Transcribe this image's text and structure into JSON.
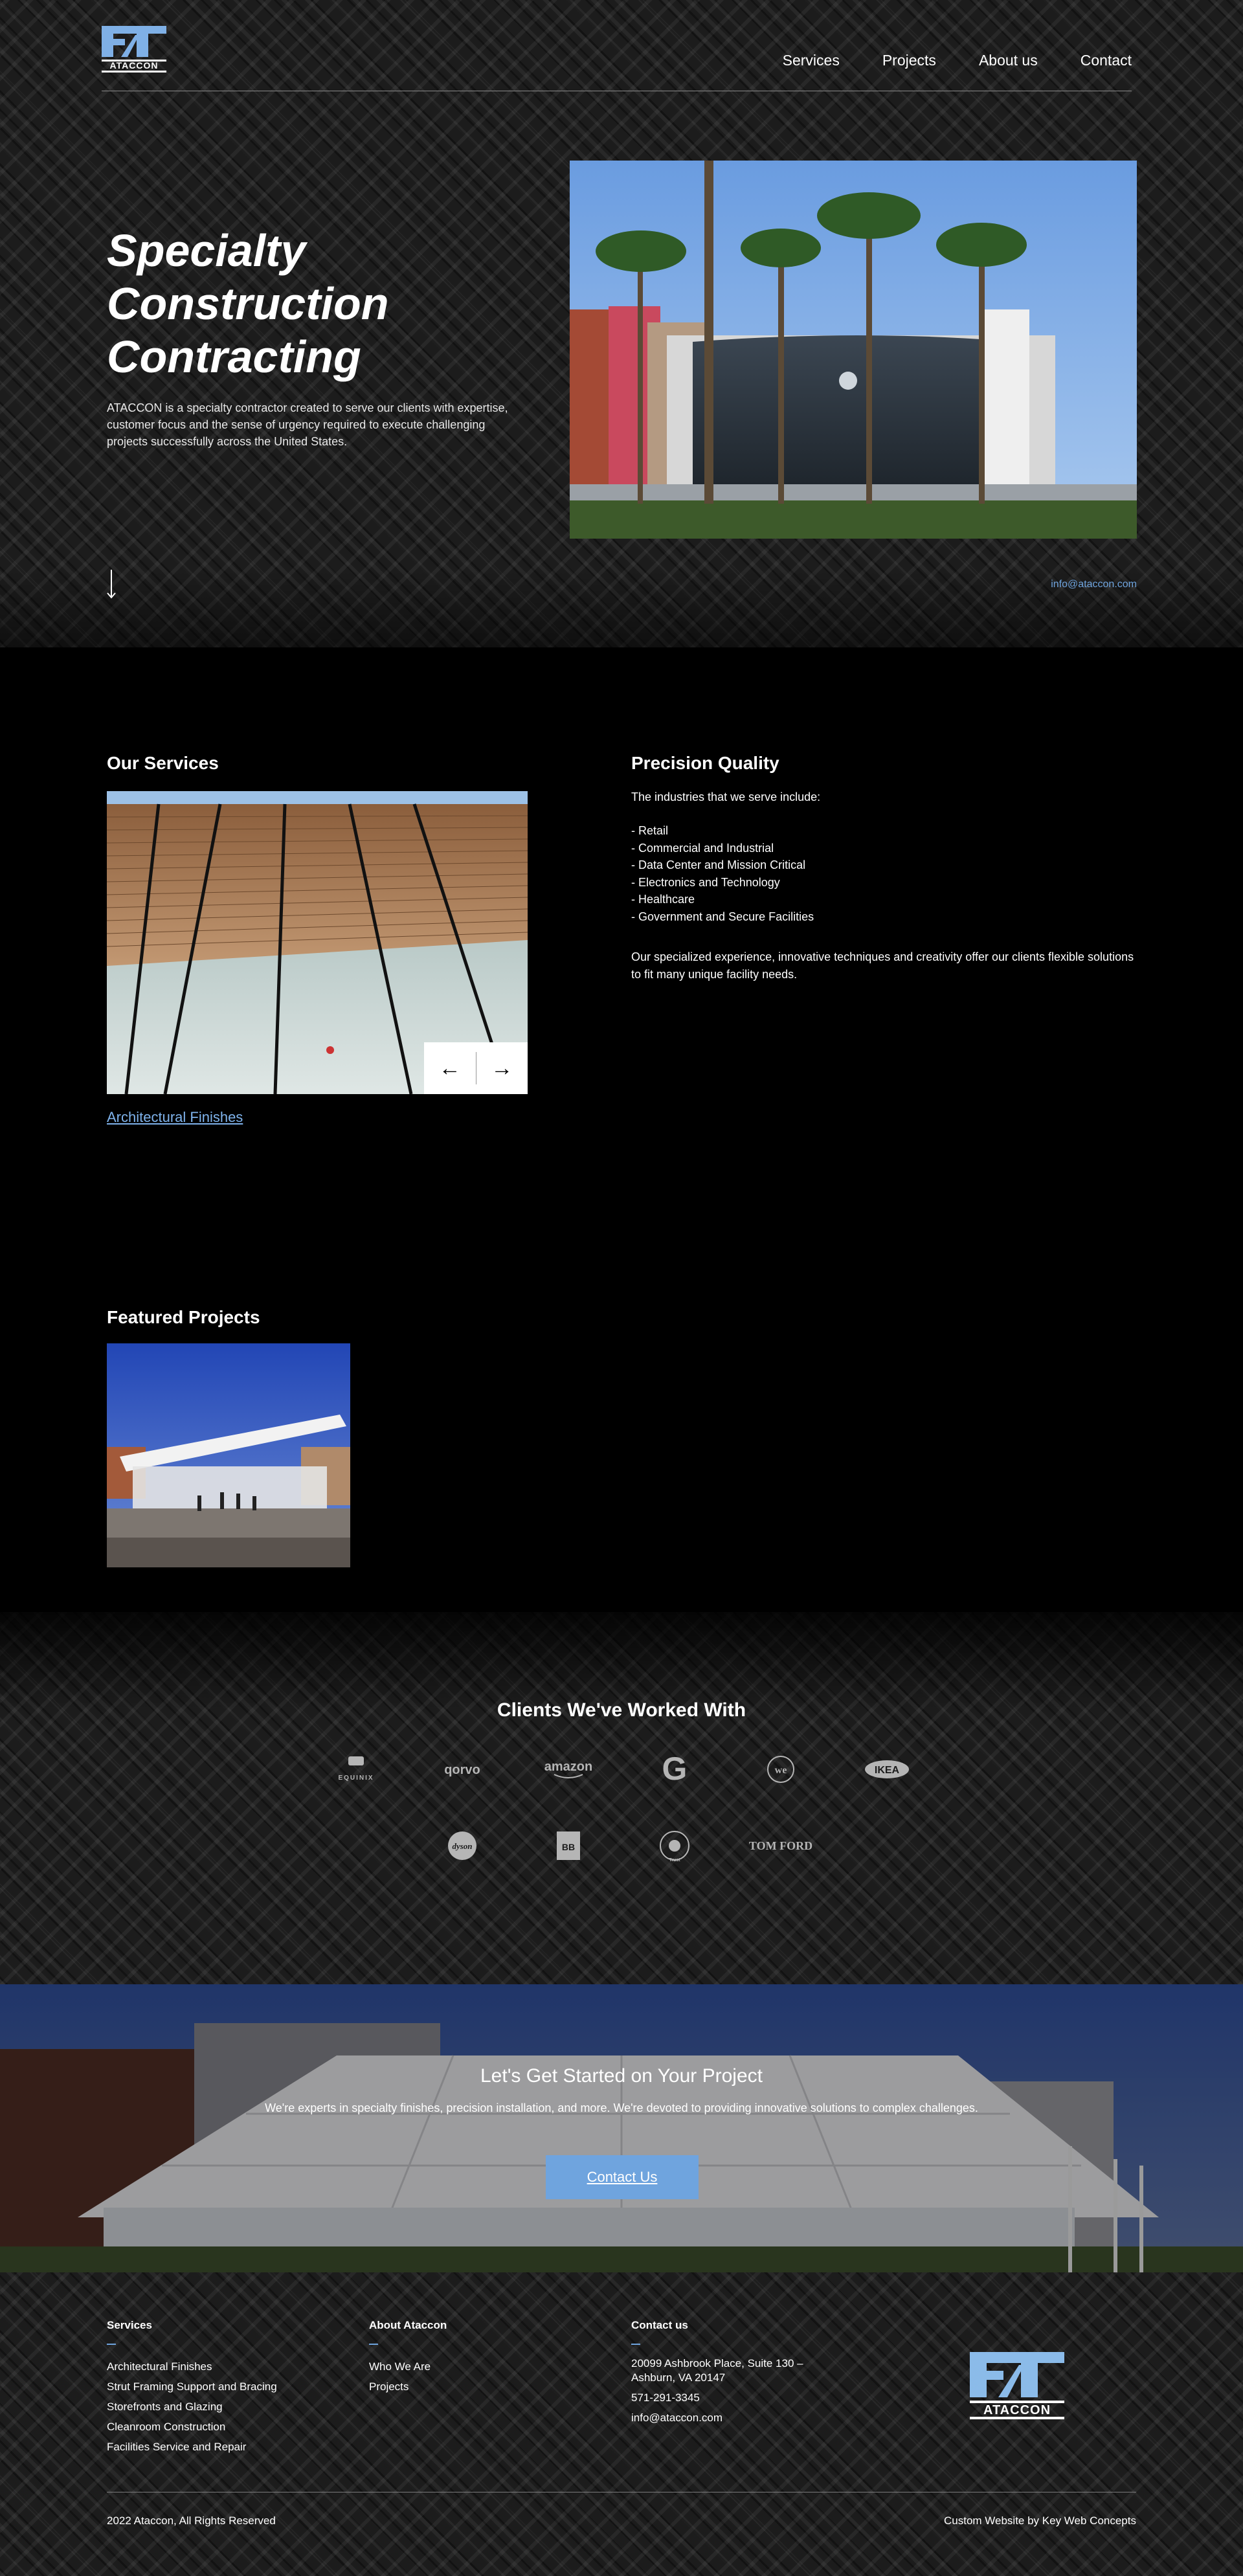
{
  "brand": {
    "logo_text": "ATACCON",
    "accent_color": "#6fa4de"
  },
  "nav": {
    "items": [
      "Services",
      "Projects",
      "About us",
      "Contact"
    ]
  },
  "hero": {
    "title_lines": [
      "Specialty",
      "Construction",
      "Contracting"
    ],
    "description": "ATACCON is a specialty contractor created to serve our clients with expertise, customer focus and the sense of urgency required to execute challenging projects successfully across the United States.",
    "email": "info@ataccon.com",
    "scroll_icon": "arrow-down-icon"
  },
  "services": {
    "title": "Our Services",
    "slide_caption": "Architectural Finishes",
    "prev_icon": "arrow-left-icon",
    "next_icon": "arrow-right-icon"
  },
  "precision": {
    "title": "Precision Quality",
    "intro": "The industries that we serve include:",
    "industries": [
      "- Retail",
      "- Commercial and Industrial",
      "- Data Center and Mission Critical",
      "- Electronics and Technology",
      "- Healthcare",
      "- Government and Secure Facilities"
    ],
    "body": "Our specialized experience, innovative techniques and creativity offer our clients flexible solutions to fit many unique facility needs."
  },
  "featured": {
    "title": "Featured Projects"
  },
  "clients": {
    "title": "Clients We've Worked With",
    "row1": [
      "EQUINIX",
      "qorvo",
      "amazon",
      "G",
      "we",
      "IKEA"
    ],
    "row2": [
      "dyson",
      "BB",
      "Trust",
      "TOM FORD"
    ]
  },
  "cta": {
    "title": "Let's Get Started on Your Project",
    "text": "We're experts in specialty finishes, precision installation, and more. We're devoted to providing innovative solutions to complex challenges.",
    "button": "Contact Us"
  },
  "footer": {
    "services_heading": "Services",
    "services": [
      "Architectural Finishes",
      "Strut Framing Support and Bracing",
      "Storefronts and Glazing",
      "Cleanroom Construction",
      "Facilities Service and Repair"
    ],
    "about_heading": "About Ataccon",
    "about": [
      "Who We Are",
      "Projects"
    ],
    "contact_heading": "Contact us",
    "address_line1": "20099 Ashbrook Place, Suite 130 –",
    "address_line2": "Ashburn, VA 20147",
    "phone": "571-291-3345",
    "email": "info@ataccon.com",
    "copyright": "2022 Ataccon, All Rights Reserved",
    "credit": "Custom Website by Key Web Concepts"
  }
}
